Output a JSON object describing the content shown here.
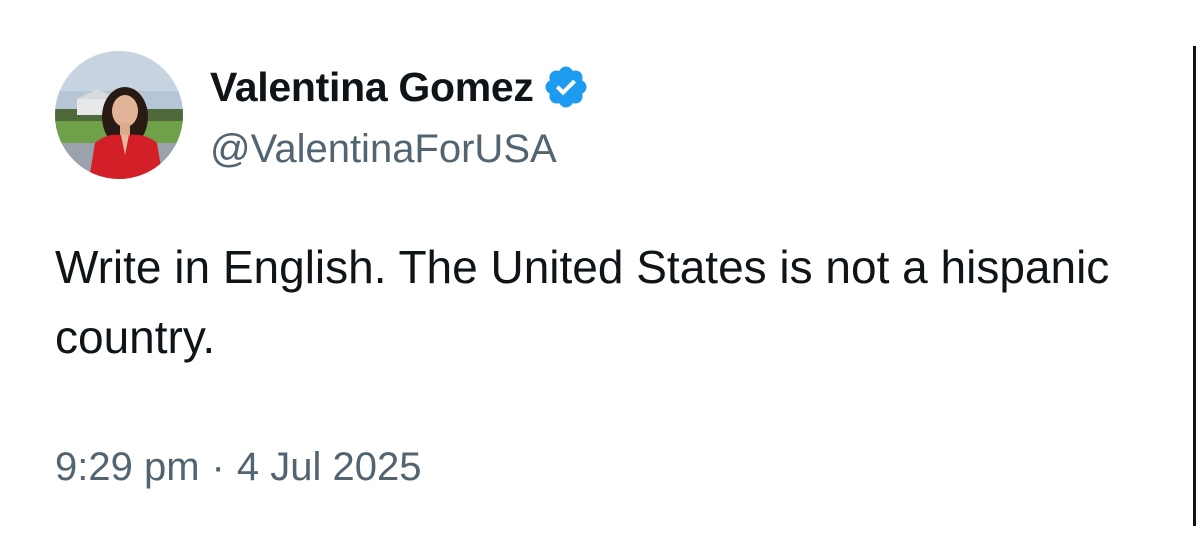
{
  "tweet": {
    "author": {
      "display_name": "Valentina Gomez",
      "handle": "@ValentinaForUSA",
      "verified_icon": "verified-badge-icon",
      "badge_color": "#1d9bf0"
    },
    "text": "Write in English. The United States is not a hispanic country.",
    "time": "9:29 pm",
    "separator": "·",
    "date": "4 Jul 2025"
  },
  "colors": {
    "text": "#0f1419",
    "secondary": "#536471",
    "background": "#ffffff"
  }
}
